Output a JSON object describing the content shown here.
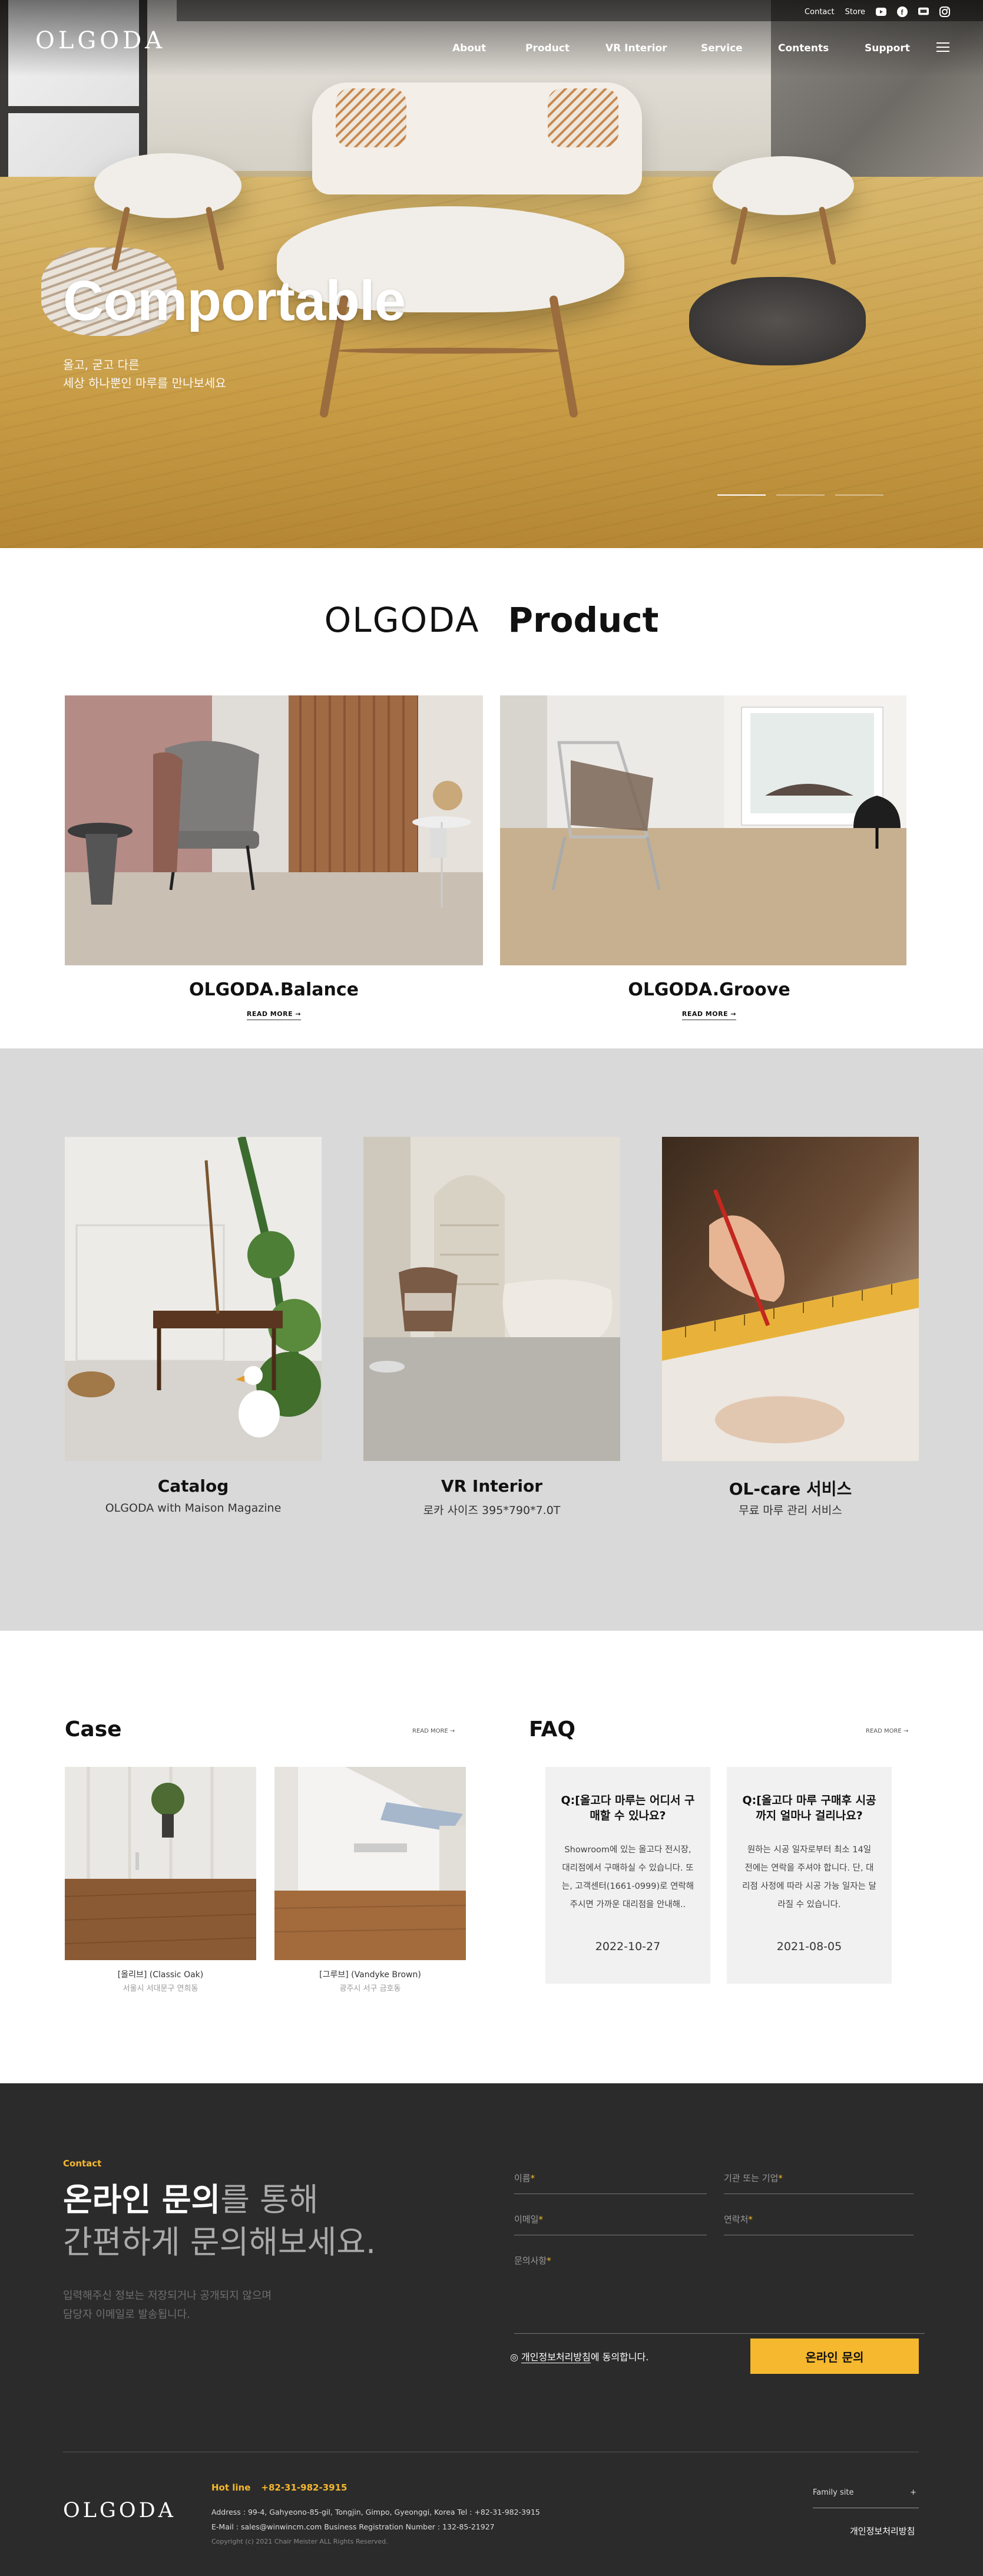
{
  "header": {
    "logo": "OLGODA",
    "top_links": [
      "Contact",
      "Store"
    ],
    "social_icons": [
      "youtube-icon",
      "facebook-icon",
      "blog-icon",
      "instagram-icon"
    ],
    "nav": [
      "About",
      "Product",
      "VR Interior",
      "Service",
      "Contents",
      "Support"
    ]
  },
  "hero": {
    "title": "Comportable",
    "subtitle_line1": "올고, 굳고 다른",
    "subtitle_line2": "세상 하나뿐인 마루를 만나보세요"
  },
  "products": {
    "title_light": "OLGODA",
    "title_bold": "Product",
    "items": [
      {
        "name": "OLGODA.Balance",
        "more": "READ MORE →"
      },
      {
        "name": "OLGODA.Groove",
        "more": "READ MORE →"
      }
    ]
  },
  "features": [
    {
      "title": "Catalog",
      "subtitle": "OLGODA with Maison Magazine"
    },
    {
      "title": "VR Interior",
      "subtitle": "로카 사이즈 395*790*7.0T"
    },
    {
      "title": "OL-care 서비스",
      "subtitle": "무료 마루 관리 서비스"
    }
  ],
  "case": {
    "title": "Case",
    "more": "READ MORE →",
    "items": [
      {
        "title": "[올리브] (Classic Oak)",
        "location": "서울시 서대문구 연희동"
      },
      {
        "title": "[그루브] (Vandyke Brown)",
        "location": "광주시 서구 금호동"
      }
    ]
  },
  "faq": {
    "title": "FAQ",
    "more": "READ MORE →",
    "items": [
      {
        "q": "Q:[올고다 마루는 어디서 구매할 수 있나요?",
        "a": "Showroom에 있는 올고다 전시장, 대리점에서 구매하실 수 있습니다. 또는, 고객센터(1661-0999)로 연락해 주시면 가까운 대리점을 안내해..",
        "date": "2022-10-27"
      },
      {
        "q": "Q:[올고다 마루 구매후 시공까지 얼마나 걸리나요?",
        "a": "원하는 시공 일자로부터 최소 14일 전에는 연락을 주셔야 합니다. 단, 대리점 사정에 따라 시공 가능 일자는 달라질 수 있습니다.",
        "date": "2021-08-05"
      }
    ]
  },
  "contact": {
    "label": "Contact",
    "heading_bold": "온라인 문의",
    "heading_rest1": "를 통해",
    "heading_line2": "간편하게 문의해보세요.",
    "note_line1": "입력해주신 정보는 저장되거나 공개되지 않으며",
    "note_line2": "담당자 이메일로 발송됩니다.",
    "fields": {
      "name": "이름",
      "org": "기관 또는 기업",
      "email": "이메일",
      "phone": "연락처",
      "message": "문의사항"
    },
    "required_mark": "*",
    "agree_text": "개인정보처리방침",
    "agree_suffix": "에 동의합니다.",
    "submit": "온라인 문의"
  },
  "footer": {
    "logo": "OLGODA",
    "hotline_label": "Hot line",
    "hotline": "+82-31-982-3915",
    "address": "Address : 99-4, Gahyeono-85-gil, Tongjin, Gimpo, Gyeonggi, Korea     Tel : +82-31-982-3915",
    "email": "E-Mail : sales@winwincm.com     Business Registration Number : 132-85-21927",
    "copyright": "Copyright (c) 2021 Chair Meister ALL Rights Reserved.",
    "family_site": "Family site",
    "privacy": "개인정보처리방침"
  },
  "colors": {
    "accent": "#f5b82e",
    "dark_bg": "#2b2b2b",
    "gray_bg": "#d9d9d9"
  }
}
